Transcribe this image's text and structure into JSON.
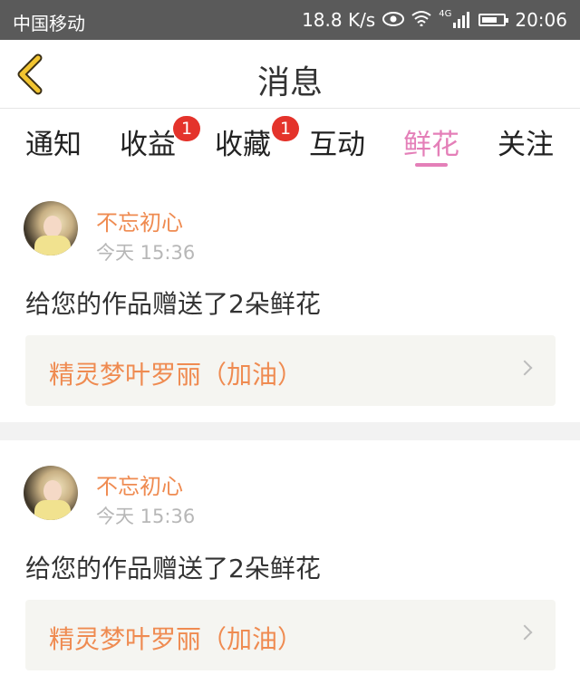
{
  "status_bar": {
    "carrier": "中国移动",
    "speed": "18.8 K/s",
    "network": "4G",
    "time": "20:06",
    "battery_level": 0.7
  },
  "nav": {
    "title": "消息",
    "back_icon": "chevron-left-icon"
  },
  "tabs": [
    {
      "label": "通知",
      "badge": ""
    },
    {
      "label": "收益",
      "badge": "1"
    },
    {
      "label": "收藏",
      "badge": "1"
    },
    {
      "label": "互动",
      "badge": ""
    },
    {
      "label": "鲜花",
      "badge": "",
      "active": true
    },
    {
      "label": "关注",
      "badge": ""
    }
  ],
  "messages": [
    {
      "sender": "不忘初心",
      "time": "今天 15:36",
      "text": "给您的作品赠送了2朵鲜花",
      "work_title": "精灵梦叶罗丽（加油）"
    },
    {
      "sender": "不忘初心",
      "time": "今天 15:36",
      "text": "给您的作品赠送了2朵鲜花",
      "work_title": "精灵梦叶罗丽（加油）"
    }
  ],
  "colors": {
    "accent": "#e47fb8",
    "orange": "#ef8b51",
    "badge": "#e4332b",
    "status_bar": "#5a5a5a"
  }
}
